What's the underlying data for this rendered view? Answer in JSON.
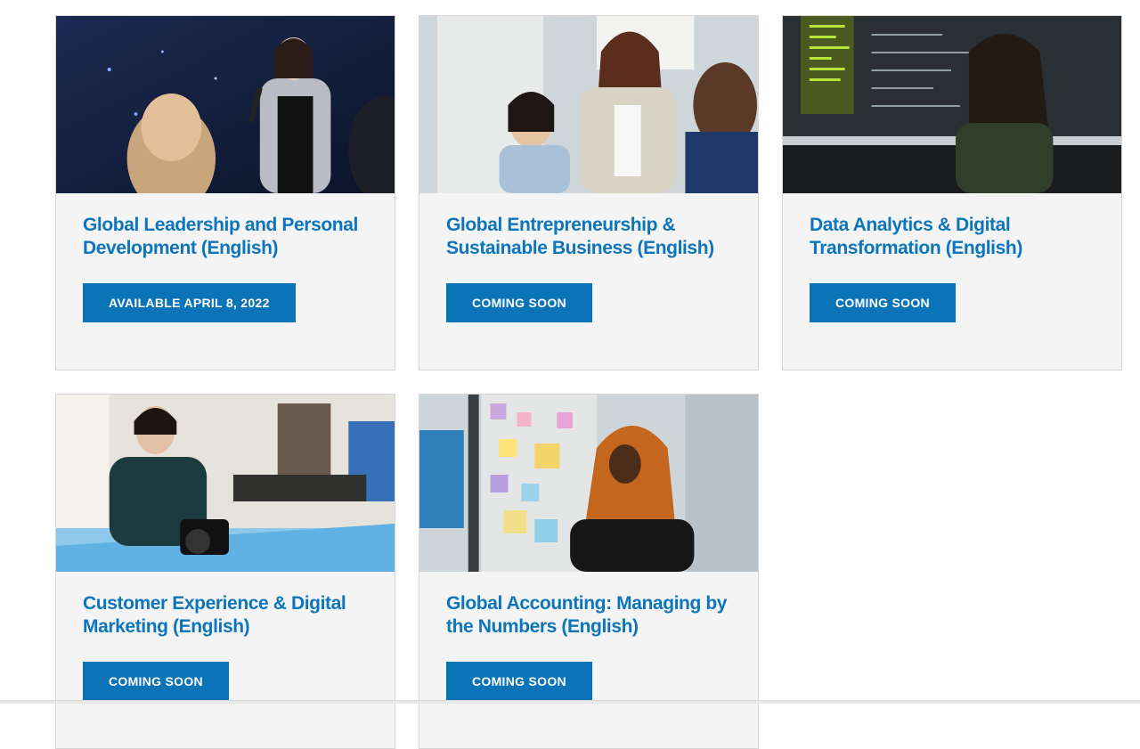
{
  "courses": [
    {
      "title": "Global Leadership and Personal Development (English)",
      "status": "AVAILABLE APRIL 8, 2022",
      "image": "speaker-with-microphone-photo"
    },
    {
      "title": "Global Entrepreneurship & Sustainable Business (English)",
      "status": "COMING SOON",
      "image": "business-handshake-photo"
    },
    {
      "title": "Data Analytics & Digital Transformation (English)",
      "status": "COMING SOON",
      "image": "data-screens-photo"
    },
    {
      "title": "Customer Experience & Digital Marketing (English)",
      "status": "COMING SOON",
      "image": "woman-with-camera-photo"
    },
    {
      "title": "Global Accounting: Managing by the Numbers (English)",
      "status": "COMING SOON",
      "image": "woman-at-sticky-note-wall-photo"
    }
  ],
  "colors": {
    "title": "#0d75bc",
    "button": "#0b73b8",
    "card_bg": "#f4f4f4"
  }
}
